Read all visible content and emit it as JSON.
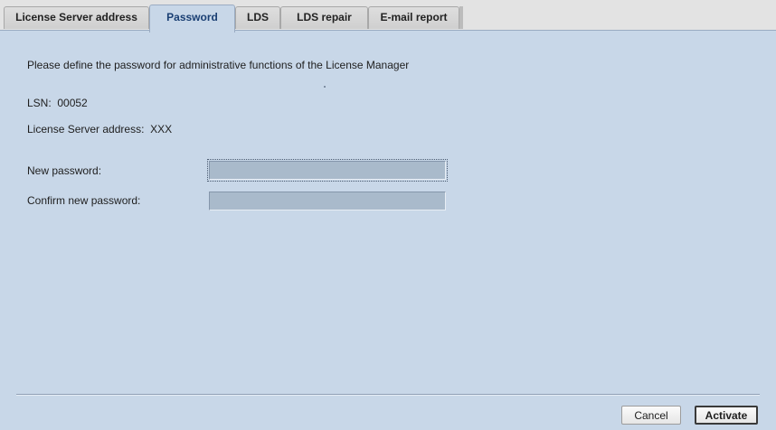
{
  "tabs": [
    {
      "label": "License Server address",
      "active": false
    },
    {
      "label": "Password",
      "active": true
    },
    {
      "label": "LDS",
      "active": false
    },
    {
      "label": "LDS repair",
      "active": false
    },
    {
      "label": "E-mail report",
      "active": false
    }
  ],
  "main": {
    "instruction": "Please define the password for administrative functions of the License Manager",
    "lsn": "LSN:  00052",
    "server_address": "License Server address:  XXX",
    "new_password_label": "New password:",
    "new_password_value": "",
    "confirm_password_label": "Confirm new password:",
    "confirm_password_value": ""
  },
  "buttons": {
    "cancel": "Cancel",
    "activate": "Activate"
  },
  "colors": {
    "panel_background": "#c8d7e8",
    "tabbar_background": "#e3e3e3",
    "active_tab_text": "#1a3f73",
    "input_background": "#a9bacb"
  }
}
